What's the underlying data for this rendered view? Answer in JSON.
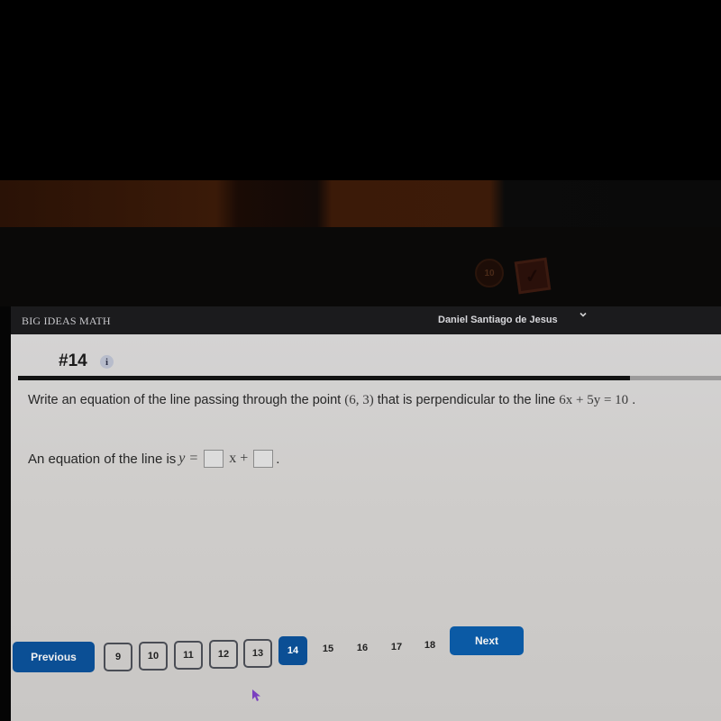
{
  "app": {
    "brand": "BIG IDEAS MATH",
    "user_name": "Daniel Santiago de Jesus",
    "user_menu_icon": "chevron-down-icon"
  },
  "question": {
    "number_label": "#14",
    "info_icon": "info-icon",
    "info_glyph": "i",
    "progress_fraction": 0.87,
    "prompt_before_point": "Write an equation of the line passing through the point",
    "point": "(6, 3)",
    "prompt_middle": "that is perpendicular to the line",
    "line_equation": "6x + 5y = 10",
    "prompt_end": ".",
    "answer_prefix": "An equation of the line is",
    "answer_lhs": "y =",
    "answer_x_term": "x +",
    "answer_end": ".",
    "slope_value": "",
    "intercept_value": ""
  },
  "pagination": {
    "previous_label": "Previous",
    "next_label": "Next",
    "pages": [
      "9",
      "10",
      "11",
      "12",
      "13",
      "14",
      "15",
      "16",
      "17",
      "18"
    ],
    "current_page": "14"
  },
  "bezel": {
    "sticker_round_text": "10",
    "sticker_check_glyph": "✓"
  },
  "colors": {
    "primary_button": "#0b4f95",
    "topbar": "#1b1b1d",
    "content_bg": "#d4d3d3"
  }
}
